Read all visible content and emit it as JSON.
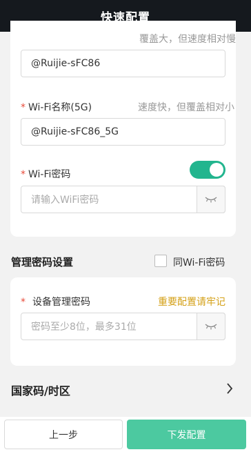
{
  "header": {
    "title": "快速配置"
  },
  "wifi24": {
    "hint": "覆盖大，但速度相对慢",
    "value": "@Ruijie-sFC86"
  },
  "wifi5g": {
    "required_mark": "*",
    "label": "Wi-Fi名称(5G)",
    "hint": "速度快，但覆盖相对小",
    "value": "@Ruijie-sFC86_5G"
  },
  "wifi_password": {
    "required_mark": "*",
    "label": "Wi-Fi密码",
    "toggle_on": true,
    "placeholder": "请输入WiFi密码",
    "eye_icon": "eye-closed-icon"
  },
  "admin_section": {
    "title": "管理密码设置",
    "same_as_wifi_label": "同Wi-Fi密码",
    "same_as_wifi_checked": false
  },
  "admin_password": {
    "required_mark": "*",
    "label": "设备管理密码",
    "warning": "重要配置请牢记",
    "placeholder": "密码至少8位，最多31位",
    "eye_icon": "eye-closed-icon"
  },
  "country": {
    "label": "国家码/时区",
    "icon": "chevron-right-icon"
  },
  "footer": {
    "prev_label": "上一步",
    "next_label": "下发配置"
  },
  "colors": {
    "accent": "#22b58e",
    "button": "#4cc9a0",
    "warning": "#d4a017",
    "required": "#e84b3a"
  }
}
